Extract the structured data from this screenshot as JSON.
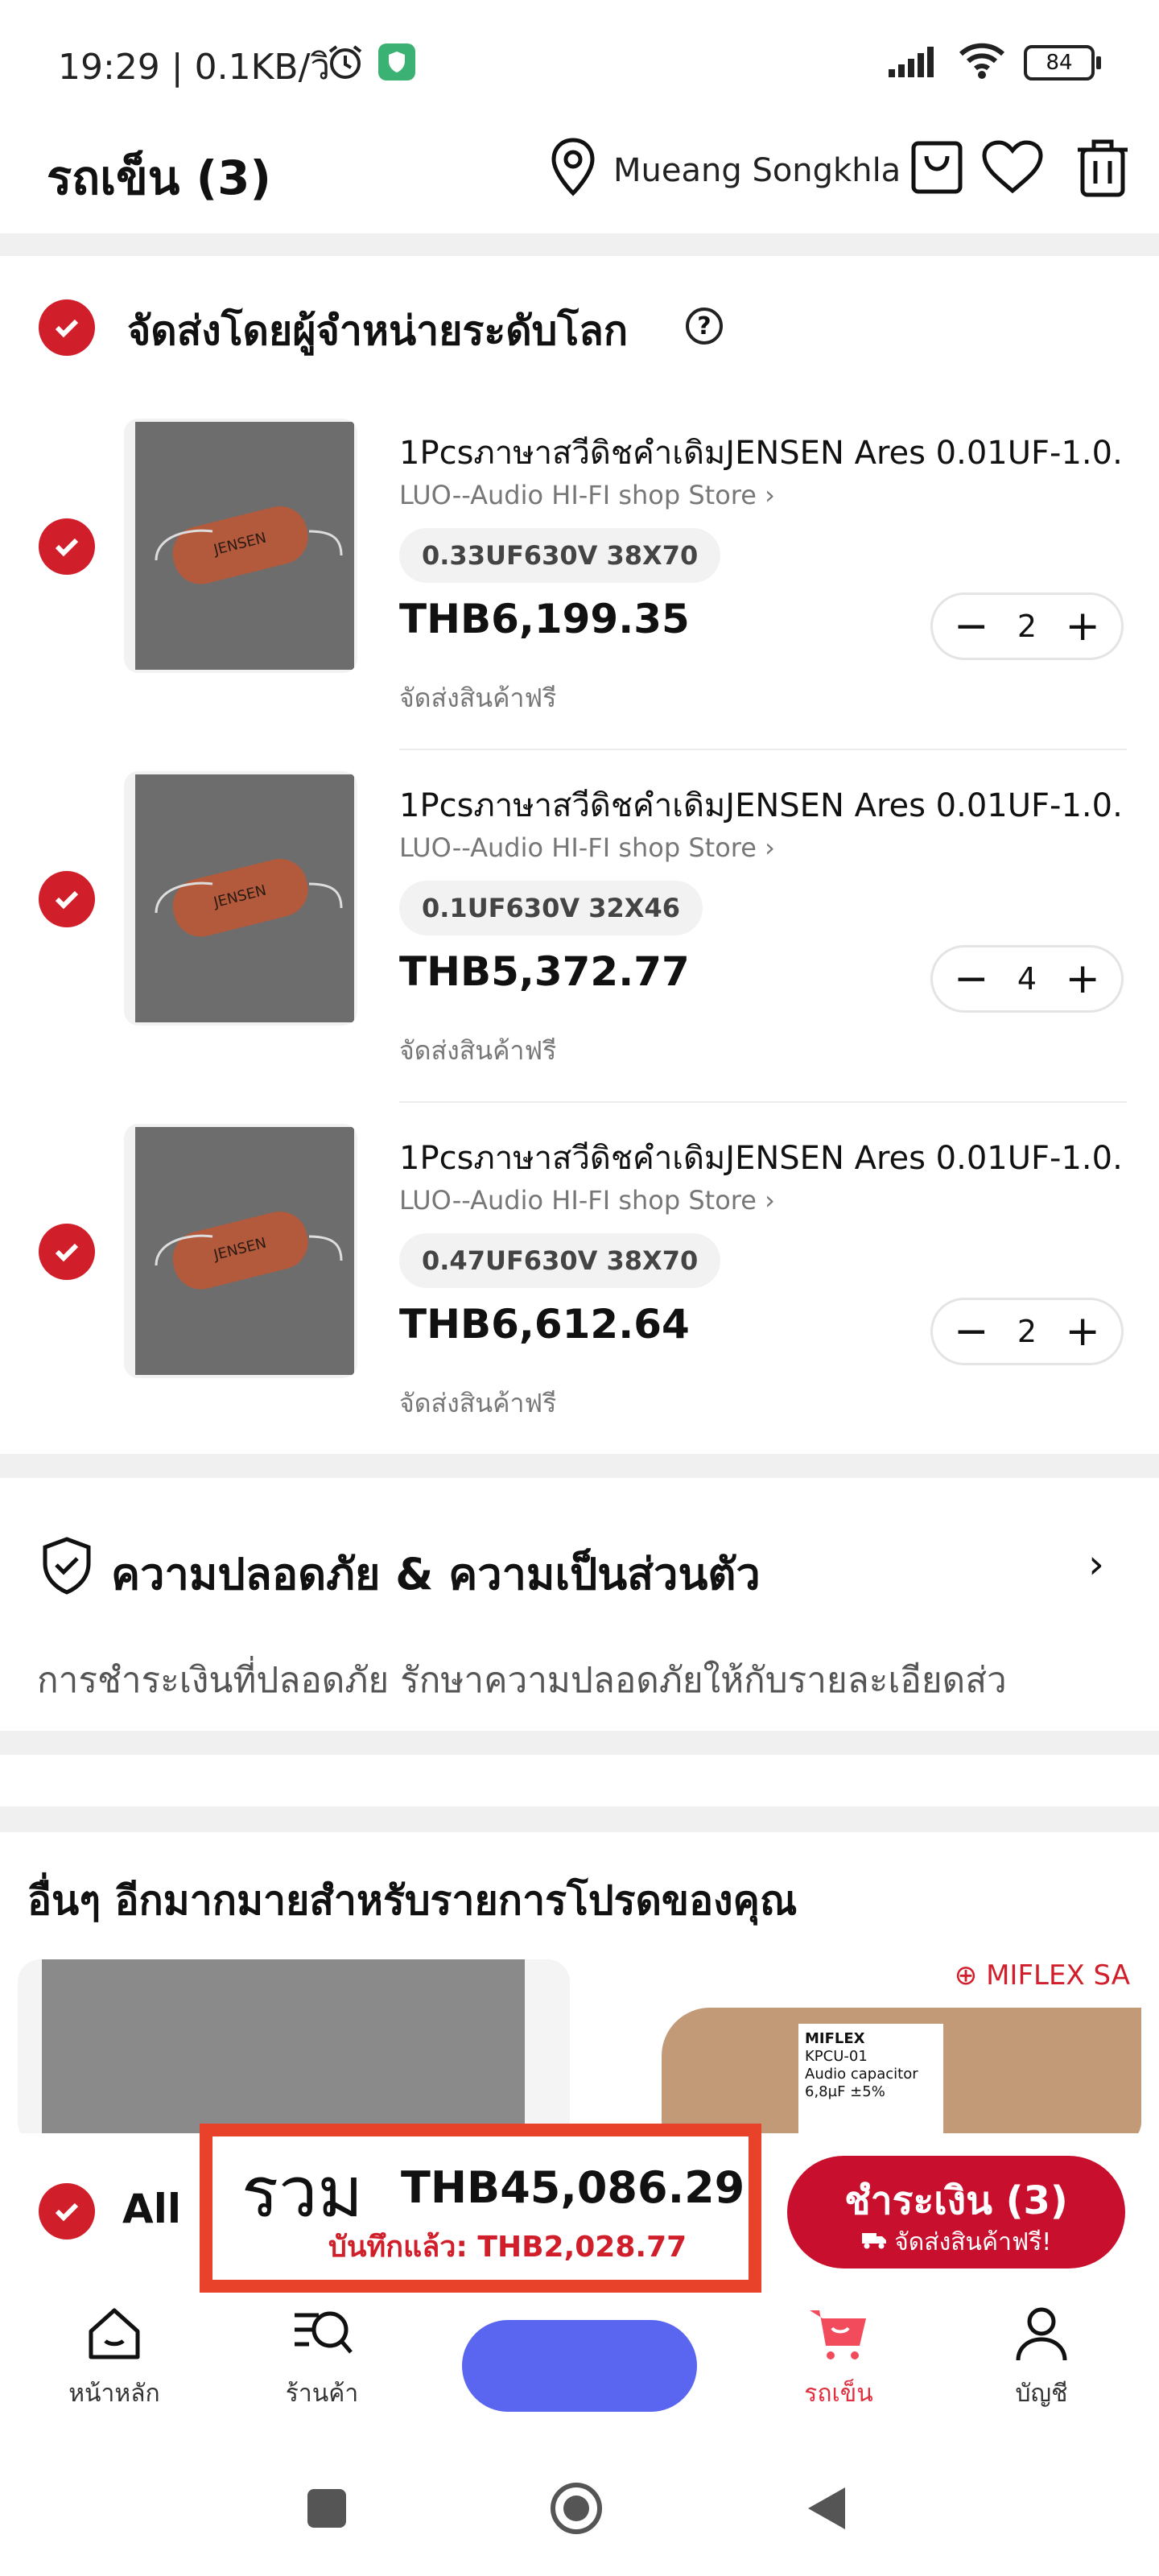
{
  "status_bar": {
    "time_text": "19:29 | 0.1KB/วิ",
    "battery": "84"
  },
  "header": {
    "title": "รถเข็น (3)",
    "location": "Mueang Songkhla"
  },
  "section": {
    "title": "จัดส่งโดยผู้จำหน่ายระดับโลก",
    "help": "?"
  },
  "items": [
    {
      "title": "1PcsภาษาสวีดิชคำเดิมJENSEN Ares 0.01UF-1.0...",
      "store": "LUO--Audio HI-FI shop Store",
      "variant": "0.33UF630V 38X70",
      "price": "THB6,199.35",
      "qty": "2",
      "shipping": "จัดส่งสินค้าฟรี"
    },
    {
      "title": "1PcsภาษาสวีดิชคำเดิมJENSEN Ares 0.01UF-1.0...",
      "store": "LUO--Audio HI-FI shop Store",
      "variant": "0.1UF630V 32X46",
      "price": "THB5,372.77",
      "qty": "4",
      "shipping": "จัดส่งสินค้าฟรี"
    },
    {
      "title": "1PcsภาษาสวีดิชคำเดิมJENSEN Ares 0.01UF-1.0...",
      "store": "LUO--Audio HI-FI shop Store",
      "variant": "0.47UF630V 38X70",
      "price": "THB6,612.64",
      "qty": "2",
      "shipping": "จัดส่งสินค้าฟรี"
    }
  ],
  "privacy": {
    "title": "ความปลอดภัย & ความเป็นส่วนตัว",
    "subtitle": "การชำระเงินที่ปลอดภัย   รักษาความปลอดภัยให้กับรายละเอียดส่ว"
  },
  "recommend": {
    "title": "อื่นๆ อีกมากมายสำหรับรายการโปรดของคุณ",
    "brand_tag": "⊕ MIFLEX SA",
    "box_brand": "MIFLEX",
    "box_model": "KPCU-01",
    "box_desc": "Audio capacitor",
    "box_value": "6,8µF ±5%"
  },
  "bottom": {
    "all_label": "All",
    "total_label": "รวม",
    "total_amount": "THB45,086.29",
    "saved": "บันทึกแล้ว: THB2,028.77",
    "checkout_label": "ชำระเงิน (3)",
    "checkout_sub": "จัดส่งสินค้าฟรี!"
  },
  "tabs": [
    {
      "label": "หน้าหลัก"
    },
    {
      "label": "ร้านค้า"
    },
    {
      "label": "รถเข็น"
    },
    {
      "label": "บัญชี"
    }
  ],
  "colors": {
    "accent": "#d01f2a",
    "highlight_box": "#e8432a",
    "pill": "#5b66f0"
  }
}
